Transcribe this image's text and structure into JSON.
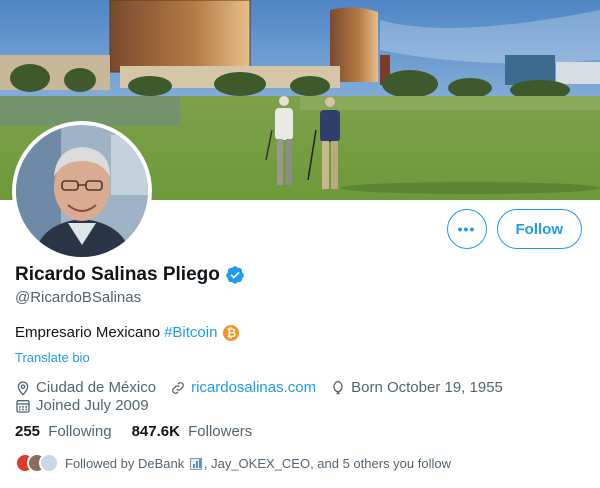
{
  "profile": {
    "name": "Ricardo Salinas Pliego",
    "handle": "@RicardoBSalinas",
    "bio_text": "Empresario Mexicano",
    "bio_hashtag": "#Bitcoin",
    "translate_label": "Translate bio",
    "location": "Ciudad de México",
    "website": "ricardosalinas.com",
    "birth": "Born October 19, 1955",
    "joined": "Joined July 2009",
    "following_count": "255",
    "following_label": "Following",
    "followers_count": "847.6K",
    "followers_label": "Followers",
    "followed_by_prefix": "Followed by DeBank",
    "followed_by_suffix": ", Jay_OKEX_CEO, and 5 others you follow"
  },
  "actions": {
    "more_label": "•••",
    "follow_label": "Follow"
  },
  "icons": [
    "verified-badge-icon",
    "location-icon",
    "link-icon",
    "birthday-icon",
    "calendar-icon",
    "more-icon",
    "bitcoin-icon",
    "bar-chart-emoji-icon"
  ],
  "colors": {
    "accent": "#1d9bf0",
    "secondary_text": "#536471",
    "bitcoin": "#f7931a"
  }
}
